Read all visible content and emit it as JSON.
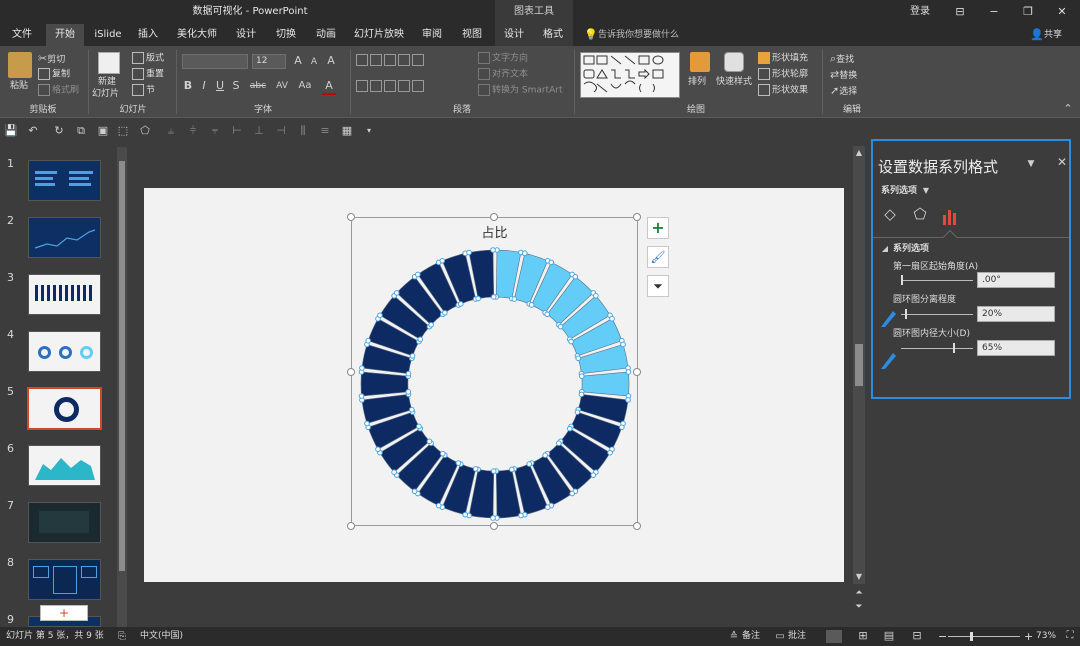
{
  "window": {
    "title": "数据可视化 - PowerPoint",
    "context_tab_group": "图表工具",
    "login": "登录",
    "minimize": "−",
    "restore": "❐",
    "close": "✕",
    "ribbon_display": "⊟"
  },
  "tabs": [
    {
      "label": "文件"
    },
    {
      "label": "开始"
    },
    {
      "label": "iSlide"
    },
    {
      "label": "插入"
    },
    {
      "label": "美化大师"
    },
    {
      "label": "设计"
    },
    {
      "label": "切换"
    },
    {
      "label": "动画"
    },
    {
      "label": "幻灯片放映"
    },
    {
      "label": "审阅"
    },
    {
      "label": "视图"
    },
    {
      "label": "设计"
    },
    {
      "label": "格式"
    }
  ],
  "tell_me": "告诉我你想要做什么",
  "share": "共享",
  "ribbon": {
    "clipboard": {
      "paste": "粘贴",
      "cut": "剪切",
      "copy": "复制",
      "format_painter": "格式刷",
      "label": "剪贴板"
    },
    "slides": {
      "new_slide": "新建",
      "new_slide2": "幻灯片",
      "layout": "版式",
      "reset": "重置",
      "section": "节",
      "label": "幻灯片"
    },
    "font": {
      "size": "12",
      "grow": "A",
      "shrink": "A",
      "clear": "A",
      "bold": "B",
      "italic": "I",
      "underline": "U",
      "strike": "S",
      "shadow": "abc",
      "spacing": "AV",
      "case": "Aa",
      "color": "A",
      "label": "字体"
    },
    "paragraph": {
      "text_direction": "文字方向",
      "align_text": "对齐文本",
      "smartart": "转换为 SmartArt",
      "label": "段落"
    },
    "drawing": {
      "arrange": "排列",
      "quick_styles": "快速样式",
      "shape_fill": "形状填充",
      "shape_outline": "形状轮廓",
      "shape_effects": "形状效果",
      "label": "绘图"
    },
    "editing": {
      "find": "查找",
      "replace": "替换",
      "select": "选择",
      "label": "编辑"
    }
  },
  "thumbnails": [
    {
      "num": "1"
    },
    {
      "num": "2"
    },
    {
      "num": "3"
    },
    {
      "num": "4"
    },
    {
      "num": "5"
    },
    {
      "num": "6"
    },
    {
      "num": "7"
    },
    {
      "num": "8"
    },
    {
      "num": "9"
    }
  ],
  "new_slide_plus": "+",
  "chart_data": {
    "type": "pie",
    "title": "占比",
    "variant": "doughnut",
    "segments": 30,
    "highlighted_segments": 8,
    "start_angle_deg": 0,
    "explosion_pct": 20,
    "hole_size_pct": 65,
    "colors": {
      "main": "#0d2a63",
      "highlight": "#63cdf8",
      "gap": "#ffffff",
      "edge": "#4aa3df"
    }
  },
  "pane": {
    "title": "设置数据系列格式",
    "options_dropdown": "系列选项",
    "section": "系列选项",
    "first_slice_label": "第一扇区起始角度(A)",
    "first_slice_value": ".00°",
    "explosion_label": "圆环图分离程度",
    "explosion_value": "20%",
    "hole_label": "圆环图内径大小(D)",
    "hole_value": "65%",
    "accent": "#2b8ce0"
  },
  "status": {
    "slide_info": "幻灯片 第 5 张，共 9 张",
    "language": "中文(中国)",
    "notes": "备注",
    "comments": "批注",
    "zoom_minus": "−",
    "zoom_plus": "+",
    "zoom": "73%"
  }
}
